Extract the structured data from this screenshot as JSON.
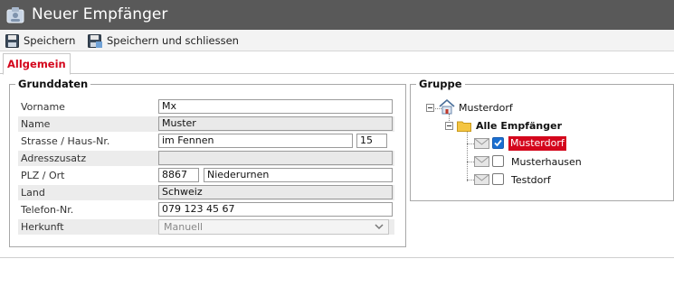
{
  "window": {
    "title": "Neuer Empfänger",
    "icon": "contact-card-icon"
  },
  "toolbar": {
    "save_label": "Speichern",
    "save_close_label": "Speichern und schliessen"
  },
  "tabs": [
    {
      "label": "Allgemein",
      "active": true
    }
  ],
  "grunddaten": {
    "legend": "Grunddaten",
    "fields": {
      "vorname": {
        "label": "Vorname",
        "value": "Mx"
      },
      "name": {
        "label": "Name",
        "value": "Muster"
      },
      "strasse": {
        "label": "Strasse / Haus-Nr.",
        "value": "im Fennen",
        "nr": "15"
      },
      "adresszusatz": {
        "label": "Adresszusatz",
        "value": ""
      },
      "plz_ort": {
        "label": "PLZ / Ort",
        "plz": "8867",
        "ort": "Niederurnen"
      },
      "land": {
        "label": "Land",
        "value": "Schweiz"
      },
      "telefon": {
        "label": "Telefon-Nr.",
        "value": "079 123 45 67"
      },
      "herkunft": {
        "label": "Herkunft",
        "value": "Manuell"
      }
    }
  },
  "gruppe": {
    "legend": "Gruppe",
    "root": {
      "label": "Musterdorf",
      "icon": "home-icon"
    },
    "folder": {
      "label": "Alle Empfänger",
      "icon": "folder-icon"
    },
    "items": [
      {
        "label": "Musterdorf",
        "checked": true,
        "selected": true
      },
      {
        "label": "Musterhausen",
        "checked": false,
        "selected": false
      },
      {
        "label": "Testdorf",
        "checked": false,
        "selected": false
      }
    ]
  },
  "colors": {
    "titlebar": "#595959",
    "accent_red": "#d4061c",
    "checkbox_blue": "#1a6fd1"
  }
}
